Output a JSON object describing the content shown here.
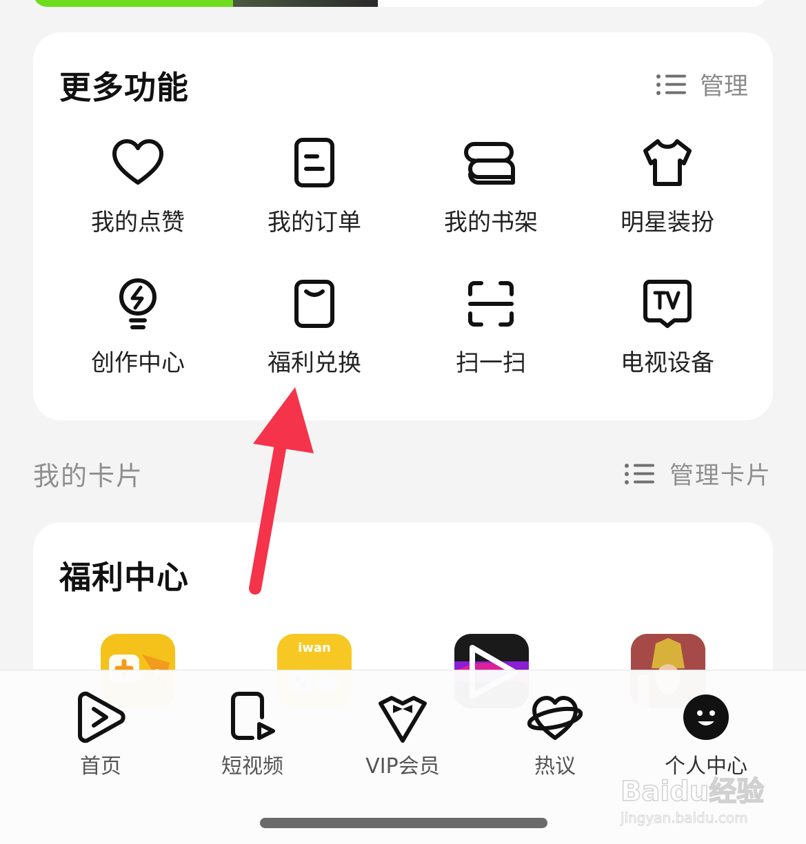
{
  "more_features": {
    "title": "更多功能",
    "manage_label": "管理",
    "items": [
      {
        "label": "我的点赞",
        "icon": "heart-icon"
      },
      {
        "label": "我的订单",
        "icon": "order-icon"
      },
      {
        "label": "我的书架",
        "icon": "bookshelf-icon"
      },
      {
        "label": "明星装扮",
        "icon": "tshirt-icon"
      },
      {
        "label": "创作中心",
        "icon": "lightbulb-icon"
      },
      {
        "label": "福利兑换",
        "icon": "gift-card-icon"
      },
      {
        "label": "扫一扫",
        "icon": "scan-icon"
      },
      {
        "label": "电视设备",
        "icon": "tv-icon"
      }
    ]
  },
  "my_cards": {
    "title": "我的卡片",
    "manage_label": "管理卡片"
  },
  "welfare": {
    "title": "福利中心",
    "apps": [
      {
        "icon": "game-app-icon",
        "color": "#f5c21b"
      },
      {
        "icon": "iwan-app-icon",
        "label": "iwan",
        "color": "#f7c823"
      },
      {
        "icon": "video-app-icon",
        "color": "#1a1a1a"
      },
      {
        "icon": "drama-app-icon",
        "color": "#b04a4a"
      }
    ]
  },
  "tabbar": {
    "tabs": [
      {
        "label": "首页",
        "icon": "play-circle-icon"
      },
      {
        "label": "短视频",
        "icon": "short-video-icon"
      },
      {
        "label": "VIP会员",
        "icon": "vip-bowtie-icon"
      },
      {
        "label": "热议",
        "icon": "heart-planet-icon"
      },
      {
        "label": "个人中心",
        "icon": "smiley-icon",
        "active": true
      }
    ]
  },
  "annotation": {
    "color": "#f5334a"
  },
  "watermark": {
    "line1": "Baidu经验",
    "line2": "jingyan.baidu.com"
  }
}
